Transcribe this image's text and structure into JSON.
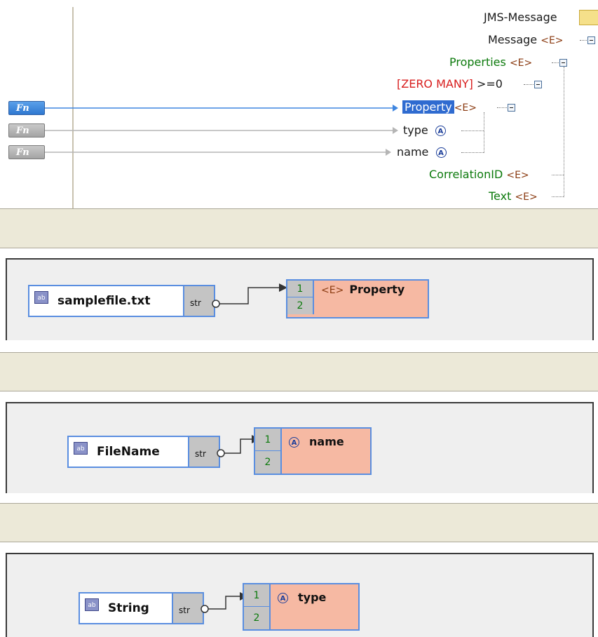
{
  "top": {
    "function_buttons": [
      "Fn",
      "Fn",
      "Fn"
    ],
    "tree": {
      "jms_message": "JMS-Message",
      "message": "Message",
      "properties": "Properties",
      "zero_many": "[ZERO MANY]",
      "zero_many_cond": ">=0",
      "property": "Property",
      "type": "type",
      "name": "name",
      "correlation_id": "CorrelationID",
      "text": "Text",
      "element_badge": "<E>",
      "attribute_badge": "A"
    }
  },
  "panels": [
    {
      "source_label": "samplefile.txt",
      "source_type_icon": "ab",
      "source_port": "str",
      "target_ports": [
        "1",
        "2"
      ],
      "target_badge": "<E>",
      "target_label": "Property"
    },
    {
      "source_label": "FileName",
      "source_type_icon": "ab",
      "source_port": "str",
      "target_ports": [
        "1",
        "2"
      ],
      "target_badge": "A",
      "target_label": "name"
    },
    {
      "source_label": "String",
      "source_type_icon": "ab",
      "source_port": "str",
      "target_ports": [
        "1",
        "2"
      ],
      "target_badge": "A",
      "target_label": "type"
    }
  ]
}
